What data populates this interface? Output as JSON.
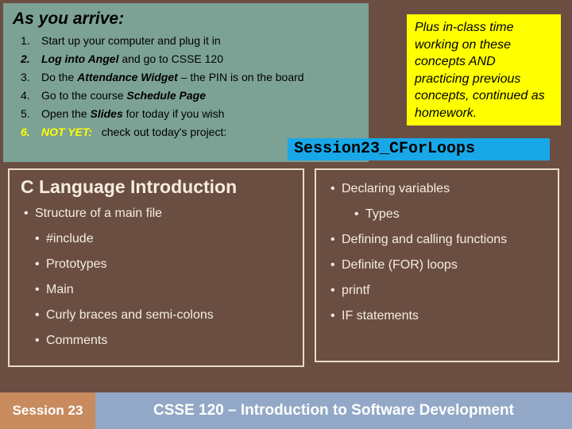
{
  "arrive": {
    "title": "As you arrive:",
    "items": [
      {
        "num": "1.",
        "html": "Start up your computer and plug it in"
      },
      {
        "num": "2.",
        "html": "<b><i>Log into Angel</i></b> and go to CSSE 120",
        "boldnum": true
      },
      {
        "num": "3.",
        "html": "Do the <b><i>Attendance Widget</i></b> – the PIN is on the board"
      },
      {
        "num": "4.",
        "html": "Go to the course <b><i>Schedule Page</i></b>"
      },
      {
        "num": "5.",
        "html": "Open the <b><i>Slides</i></b> for today if you wish"
      },
      {
        "num": "6.",
        "html": "<span class='not-yet'>NOT YET:</span> &nbsp; check out today's project:",
        "boldnum": true,
        "yellownum": true
      }
    ]
  },
  "yellow_note": "Plus in-class time working on these concepts AND practicing previous concepts, continued as homework.",
  "project": "Session23_CForLoops",
  "left_box": {
    "title": "C Language  Introduction",
    "top": [
      "Structure of a   main   file"
    ],
    "sub": [
      "#include",
      "Prototypes",
      "Main",
      "Curly braces and semi-colons",
      "Comments"
    ]
  },
  "right_box": {
    "items": [
      "Declaring variables"
    ],
    "sub": [
      "Types"
    ],
    "items2": [
      "Defining and calling functions",
      "Definite (FOR) loops",
      "printf",
      "IF statements"
    ]
  },
  "footer": {
    "session": "Session 23",
    "course": "CSSE 120 – Introduction to Software Development"
  }
}
